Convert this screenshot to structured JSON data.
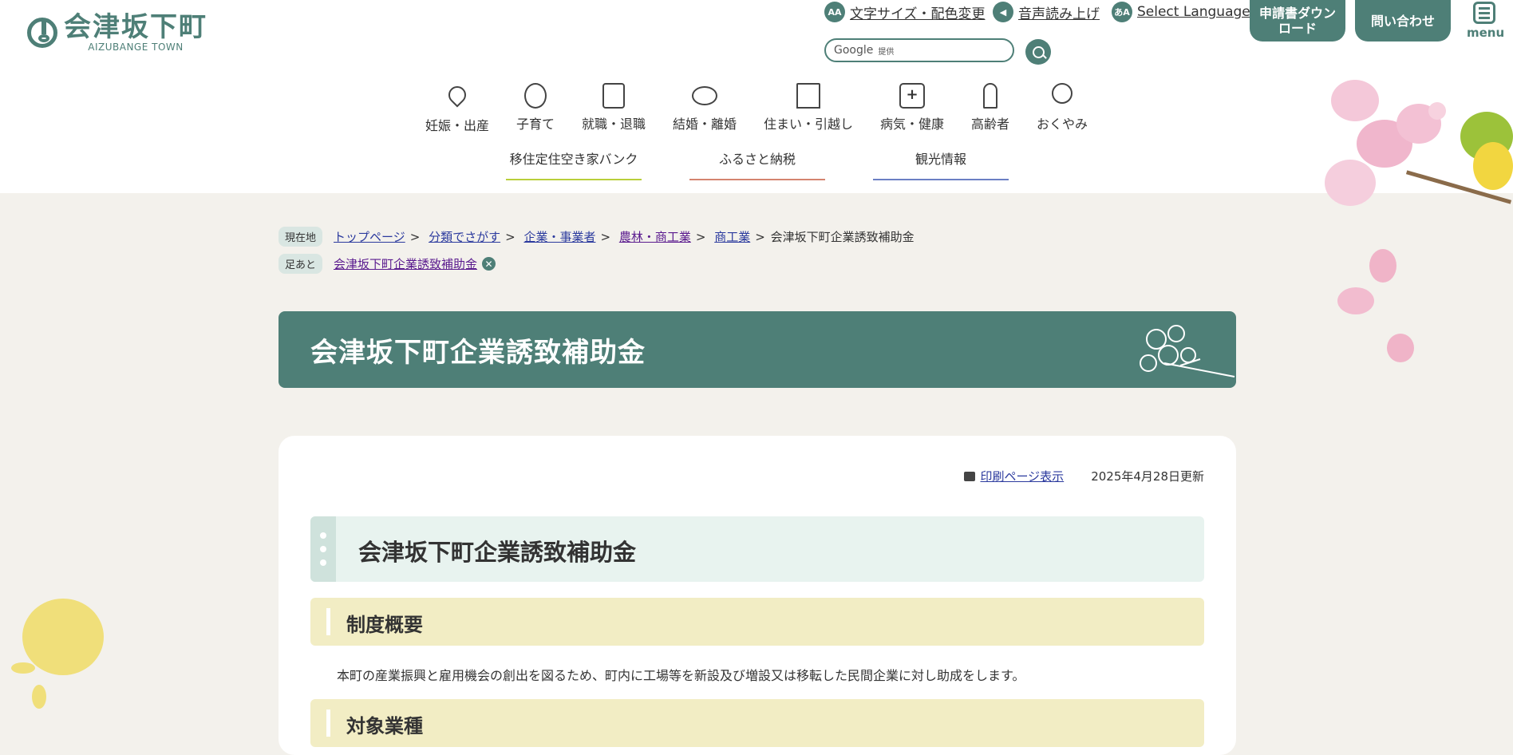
{
  "logo": {
    "title": "会津坂下町",
    "subtitle": "AIZUBANGE TOWN"
  },
  "utility": {
    "text_size": {
      "icon": "text-size-icon",
      "icon_text": "AA",
      "label": "文字サイズ・配色変更"
    },
    "voice": {
      "icon": "speaker-icon",
      "label": "音声読み上げ"
    },
    "language": {
      "icon": "language-icon",
      "icon_text": "あA",
      "label": "Select Language"
    }
  },
  "search": {
    "google": "Google",
    "provided": "提供"
  },
  "top_buttons": {
    "download": "申請書ダウンロード",
    "contact": "問い合わせ",
    "menu": "menu"
  },
  "life_nav": [
    {
      "label": "妊娠・出産",
      "icon": "pregnancy-icon"
    },
    {
      "label": "子育て",
      "icon": "child-icon"
    },
    {
      "label": "就職・退職",
      "icon": "briefcase-icon"
    },
    {
      "label": "結婚・離婚",
      "icon": "rings-icon"
    },
    {
      "label": "住まい・引越し",
      "icon": "house-icon"
    },
    {
      "label": "病気・健康",
      "icon": "medical-icon"
    },
    {
      "label": "高齢者",
      "icon": "elderly-icon"
    },
    {
      "label": "おくやみ",
      "icon": "flower-icon"
    }
  ],
  "sub_nav": [
    {
      "label": "移住定住空き家バンク",
      "color": "#b9cf3a"
    },
    {
      "label": "ふるさと納税",
      "color": "#d4846f"
    },
    {
      "label": "観光情報",
      "color": "#6b7fc4"
    }
  ],
  "breadcrumb": {
    "tag": "現在地",
    "items": [
      "トップページ",
      "分類でさがす",
      "企業・事業者",
      "農林・商工業",
      "商工業"
    ],
    "current": "会津坂下町企業誘致補助金"
  },
  "footprint": {
    "tag": "足あと",
    "item": "会津坂下町企業誘致補助金"
  },
  "page_title": "会津坂下町企業誘致補助金",
  "content": {
    "print_label": "印刷ページ表示",
    "updated": "2025年4月28日更新",
    "heading": "会津坂下町企業誘致補助金",
    "section1": "制度概要",
    "paragraph": "本町の産業振興と雇用機会の創出を図るため、町内に工場等を新設及び増設又は移転した民間企業に対し助成をします。",
    "section2": "対象業種"
  },
  "colors": {
    "brand": "#4e7f77",
    "heading_bg": "#e8f3ef",
    "section_bg": "#f2edc4"
  }
}
